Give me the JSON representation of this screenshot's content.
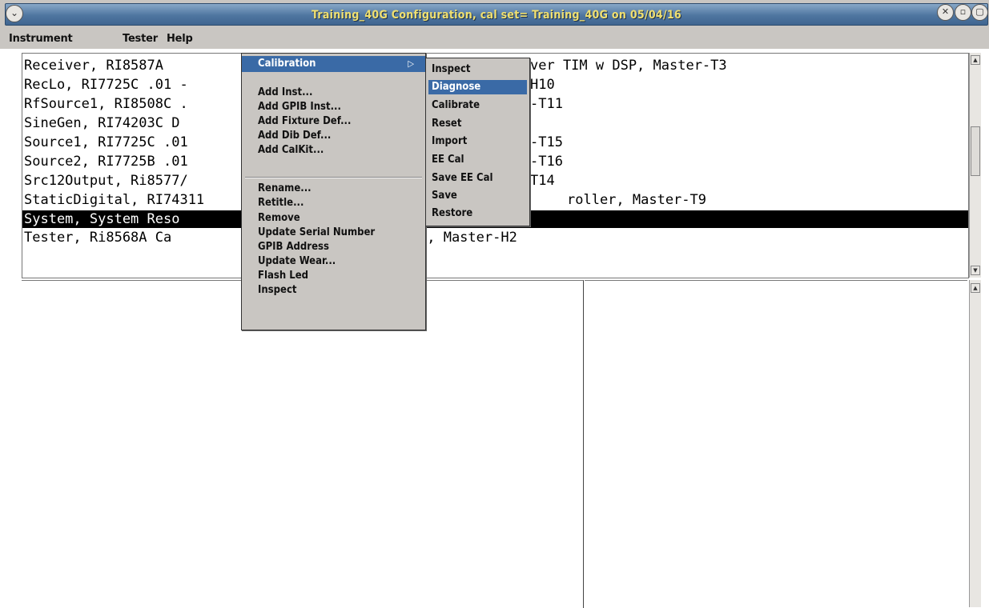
{
  "window": {
    "title": "Training_40G Configuration,  cal set= Training_40G on 05/04/16",
    "menu_icon": "chevron-down-icon",
    "close_icon": "close-icon",
    "minimize_icon": "minimize-icon",
    "maximize_icon": "maximize-icon"
  },
  "menubar": {
    "items": [
      "Instrument",
      "Tester",
      "Help"
    ]
  },
  "list": {
    "rows": [
      {
        "left": "Receiver, RI8587A",
        "right": "ver TIM w DSP, Master-T3"
      },
      {
        "left": "RecLo, RI7725C .01 -",
        "right": "H10"
      },
      {
        "left": "RfSource1, RI8508C .",
        "right": "-T11"
      },
      {
        "left": "SineGen, RI74203C D",
        "right": ""
      },
      {
        "left": "Source1, RI7725C .01",
        "right": "-T15"
      },
      {
        "left": "Source2, RI7725B .01",
        "right": "-T16"
      },
      {
        "left": "Src12Output, Ri8577/",
        "right": "T14"
      },
      {
        "left": "StaticDigital, RI74311",
        "right": "roller, Master-T9"
      },
      {
        "left": "System, System Reso",
        "right": ""
      },
      {
        "left": "Tester, Ri8568A Ca",
        "right": "r, Master-H2"
      }
    ],
    "selected_index": 8
  },
  "context_menu": {
    "items": [
      "Calibration",
      "Add Inst...",
      "Add GPIB Inst...",
      "Add Fixture Def...",
      "Add Dib Def...",
      "Add CalKit...",
      "Rename...",
      "Retitle...",
      "Remove",
      "Update Serial Number",
      "GPIB Address",
      "Update Wear...",
      "Flash Led",
      "Inspect"
    ],
    "submenu_arrow": "chevron-right-icon"
  },
  "calibration_submenu": {
    "items": [
      "Inspect",
      "Diagnose",
      "Calibrate",
      "Reset",
      "Import",
      "EE Cal",
      "Save EE Cal",
      "Save",
      "Restore"
    ],
    "highlighted": "Diagnose"
  },
  "colors": {
    "titlebar": "#4f76a0",
    "title_text": "#f0e070",
    "chrome": "#c9c6c2",
    "highlight": "#3a6aa6",
    "selection": "#000000"
  }
}
